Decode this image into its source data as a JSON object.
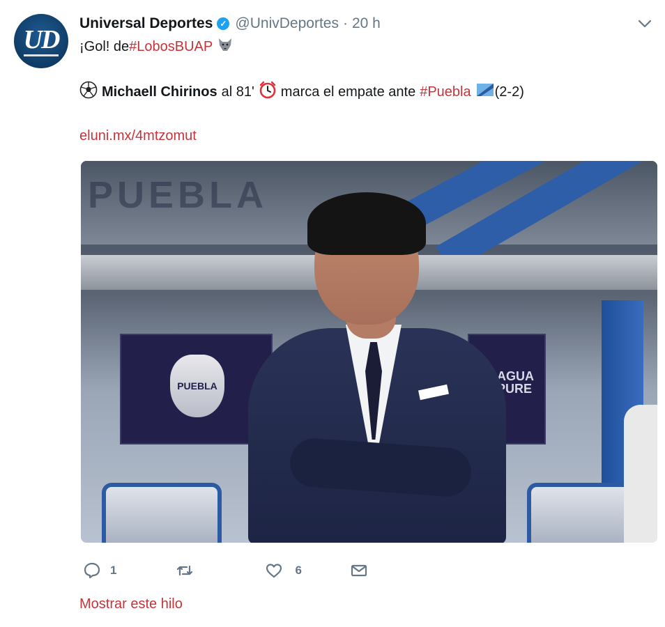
{
  "tweet": {
    "author_name": "Universal Deportes",
    "handle": "@UnivDeportes",
    "separator": "·",
    "time": "20 h",
    "avatar_text": "UD",
    "line1": {
      "prefix": "¡Gol! de ",
      "hashtag": "#LobosBUAP"
    },
    "line2": {
      "player": "Michaell Chirinos",
      "minute_text": "al 81'",
      "middle": "marca el empate ante",
      "hashtag": "#Puebla",
      "score": "(2-2)"
    },
    "link": "eluni.mx/4mtzomut",
    "actions": {
      "replies": "1",
      "likes": "6"
    },
    "show_thread": "Mostrar este hilo"
  },
  "image_text": {
    "roof_text": "PUEBLA",
    "panel_left_crest": "PUEBLA",
    "panel_right_text": "AGUA PURE"
  },
  "icons": {
    "verified": "verified-badge-icon",
    "caret": "chevron-down-icon",
    "wolf": "wolf-emoji-icon",
    "soccer": "soccer-ball-emoji-icon",
    "clock": "alarm-clock-emoji-icon",
    "flag": "flag-emoji-icon",
    "reply": "reply-icon",
    "retweet": "retweet-icon",
    "like": "heart-icon",
    "dm": "envelope-icon"
  },
  "colors": {
    "hashtag": "#c6343b",
    "verified": "#1da1f2",
    "muted": "#657786"
  }
}
